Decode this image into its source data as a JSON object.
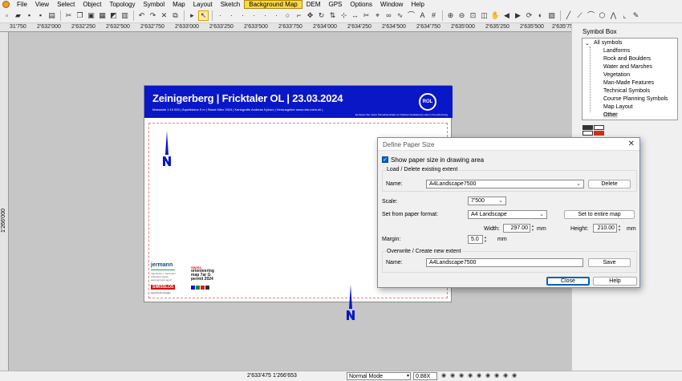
{
  "menu": [
    "File",
    "View",
    "Select",
    "Object",
    "Topology",
    "Symbol",
    "Map",
    "Layout",
    "Sketch",
    "Background Map",
    "DEM",
    "GPS",
    "Options",
    "Window",
    "Help"
  ],
  "menu_active": "Background Map",
  "ruler": {
    "top": [
      "31'750",
      "2'632'000",
      "2'632'250",
      "2'632'500",
      "2'632'750",
      "2'633'000",
      "2'633'250",
      "2'633'500",
      "2'633'750",
      "2'634'000",
      "2'634'250",
      "2'634'500",
      "2'634'750",
      "2'635'000",
      "2'635'250",
      "2'635'500",
      "2'635'750"
    ],
    "left": "1'266'000"
  },
  "map": {
    "title": "Zeinigerberg | Fricktaler OL | 23.03.2024",
    "subtitle": "Massstab 1:10 000 | Äquidistanz 5 m | Stand März 2024 | Kartografie Andreas Kyburz | Herausgeber www.rols-mein.ch |",
    "note": "Es lassen Sie meine Schreibwerkstatt vor Telekommunikationen oder in Fremdnutzung",
    "logo_text": "ROL",
    "sponsor_jermann": "jermann",
    "sponsor_jermann_lines": [
      "Ingenieure + Geometer",
      "Arlesheim Aarau",
      "www.jermann-ag.ch"
    ],
    "sponsor_swiss_red": "SWISS",
    "sponsor_swiss_lines": [
      "orienteering",
      "map 7ar G",
      "permit 2024"
    ],
    "sponsor_sport": "SWISSLOS",
    "sponsor_sport_sub": "Sportfonds Aargau",
    "accent_color": "#0a17c7"
  },
  "symbol_box": {
    "title": "Symbol Box",
    "root": "All symbols",
    "items": [
      "Landforms",
      "Rock and Boulders",
      "Water and Marshes",
      "Vegetation",
      "Man-Made Features",
      "Technical Symbols",
      "Course Planning Symbols",
      "Map Layout",
      "Other"
    ],
    "selected": "Other"
  },
  "status": {
    "coord_x": "2'633'475",
    "coord_y": "1'266'653",
    "mode": "Normal Mode",
    "zoom": "0.88X"
  },
  "dialog": {
    "title": "Define Paper Size",
    "show_paper_label": "Show paper size in drawing area",
    "show_paper_checked": true,
    "load_group": "Load / Delete existing extent",
    "name_label": "Name:",
    "name_value": "A4Landscape7500",
    "delete_label": "Delete",
    "scale_label": "Scale:",
    "scale_value": "7'500",
    "format_label": "Set from paper format:",
    "format_value": "A4 Landscape",
    "entire_map_label": "Set to entire map",
    "width_label": "Width:",
    "width_value": "297.00",
    "height_label": "Height:",
    "height_value": "210.00",
    "unit": "mm",
    "margin_label": "Margin:",
    "margin_value": "5.0",
    "overwrite_group": "Overwrite / Create new extent",
    "new_name_label": "Name:",
    "new_name_value": "A4Landscape7500",
    "save_label": "Save",
    "close_label": "Close",
    "help_label": "Help"
  }
}
